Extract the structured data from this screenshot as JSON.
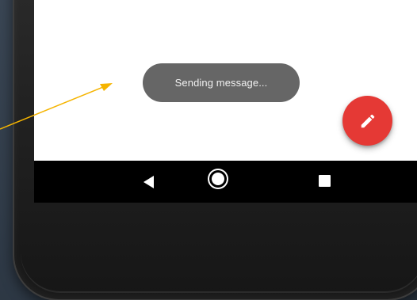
{
  "toast": {
    "text": "Sending message..."
  },
  "fab": {
    "icon": "pencil-icon",
    "color": "#e53935"
  },
  "navigation_bar": {
    "back_icon": "back-triangle-icon",
    "home_icon": "home-circle-icon",
    "recents_icon": "recents-square-icon"
  },
  "annotation": {
    "arrow_color": "#f5b400"
  }
}
